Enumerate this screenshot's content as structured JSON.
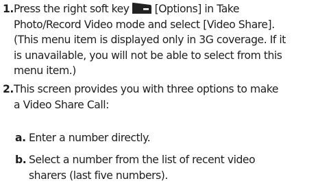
{
  "steps": [
    {
      "number": "1.",
      "lines": {
        "l1_before_icon": "Press the right soft key",
        "l1_after_icon": "[Options] in Take",
        "l2": "Photo/Record Video mode and select [Video Share].",
        "l3": "(This menu item is displayed only in 3G coverage. If it",
        "l4": "is unavailable, you will not be able to select from this",
        "l5": "menu item.)"
      },
      "icon": "right-soft-key-icon"
    },
    {
      "number": "2.",
      "lines": {
        "l1": "This screen provides you with three options to make",
        "l2": "a Video Share Call:"
      },
      "substeps": [
        {
          "letter": "a.",
          "lines": [
            "Enter a number directly."
          ]
        },
        {
          "letter": "b.",
          "lines": [
            "Select a number from the list of recent video",
            "sharers (last five numbers)."
          ]
        }
      ]
    }
  ]
}
